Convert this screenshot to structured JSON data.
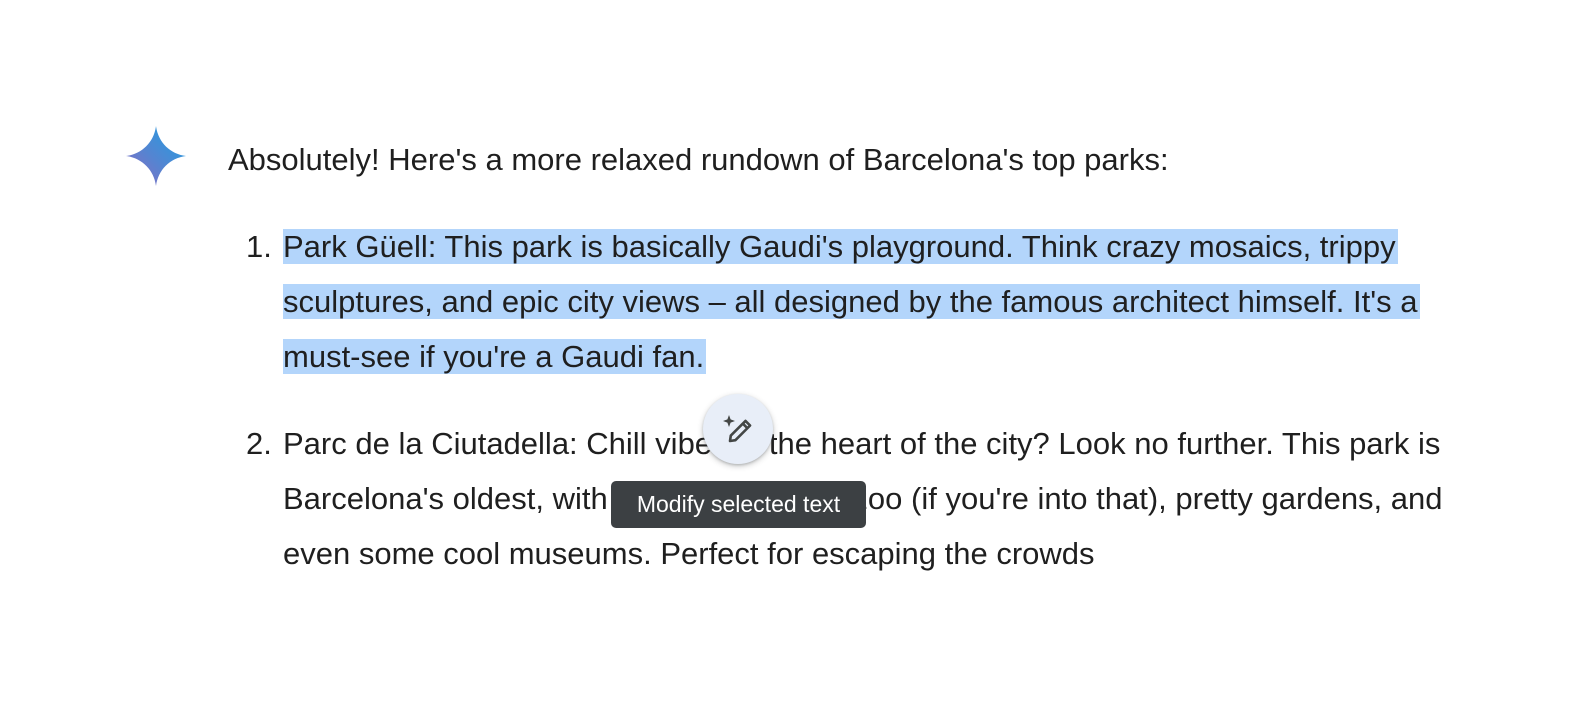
{
  "response": {
    "intro": "Absolutely! Here's a more relaxed rundown of Barcelona's top parks:",
    "items": [
      {
        "number": "1.",
        "text": "Park Güell: This park is basically Gaudi's playground. Think crazy mosaics, trippy sculptures, and epic city views – all designed by the famous architect himself. It's a must-see if you're a Gaudi fan.",
        "selected": true
      },
      {
        "number": "2.",
        "text": "Parc de la Ciutadella: Chill vibes in the heart of the city? Look no further. This park is Barcelona's oldest, with a boating lake, a zoo (if you're into that), pretty gardens, and even some cool museums. Perfect for escaping the crowds",
        "selected": false
      }
    ]
  },
  "modify_button": {
    "icon": "magic-pencil-icon",
    "tooltip": "Modify selected text"
  },
  "icons": {
    "assistant": "gemini-spark-icon"
  },
  "colors": {
    "selection": "#b3d5fb",
    "tooltip_bg": "#3c4043",
    "fab_bg": "#e8eef8",
    "spark_start": "#9168c0",
    "spark_mid": "#5684d1",
    "spark_end": "#1ba1e3"
  }
}
